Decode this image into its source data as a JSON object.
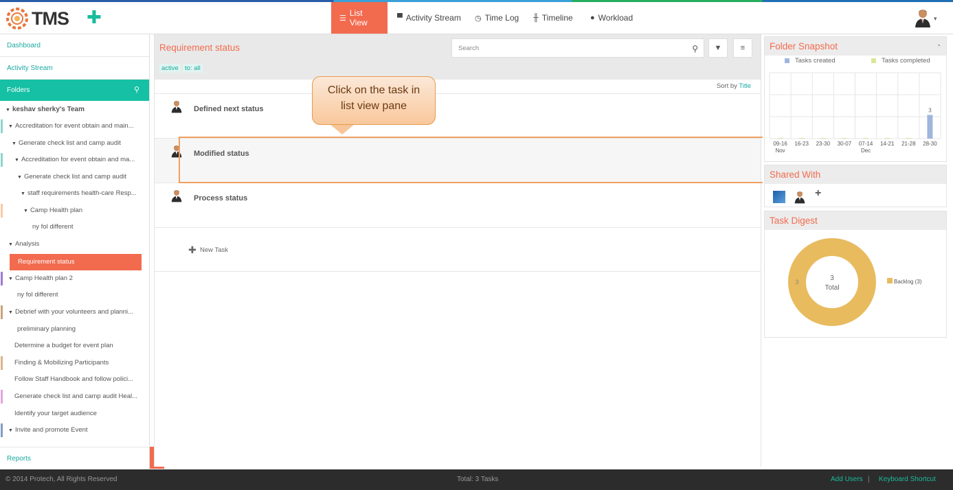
{
  "app": {
    "logo_text": "TMS",
    "add_icon": "plus-icon"
  },
  "nav": {
    "items": [
      {
        "label": "List View",
        "icon": "list-icon",
        "active": true
      },
      {
        "label": "Activity Stream",
        "icon": "comment-icon"
      },
      {
        "label": "Time Log",
        "icon": "clock-icon"
      },
      {
        "label": "Timeline",
        "icon": "sliders-icon"
      },
      {
        "label": "Workload",
        "icon": "user-icon"
      }
    ],
    "caret": "▾"
  },
  "sidebar": {
    "dashboard": "Dashboard",
    "activity_stream": "Activity Stream",
    "folders": "Folders",
    "team": "keshav sherky's Team",
    "tree": [
      {
        "label": "Accreditation for event obtain and main...",
        "bar": "#8fd3cf"
      },
      {
        "label": "Generate check list and camp audit"
      },
      {
        "label": "Accreditation for event obtain and ma...",
        "bar": "#8fd3cf"
      },
      {
        "label": "Generate check list and camp audit"
      },
      {
        "label": "staff requirements health-care Resp..."
      },
      {
        "label": "Camp Health plan",
        "bar": "#f9c9a3"
      },
      {
        "label": "ny fol different"
      },
      {
        "label": "Analysis"
      },
      {
        "label": "Requirement status"
      },
      {
        "label": "Camp Health plan 2",
        "bar": "#9b7bd1"
      },
      {
        "label": "ny fol different"
      },
      {
        "label": "Debrief with your volunteers and planni...",
        "bar": "#c9a27e"
      },
      {
        "label": "preliminary planning"
      },
      {
        "label": "Determine a budget for event plan"
      },
      {
        "label": "Finding & Mobilizing Participants",
        "bar": "#d9b48a"
      },
      {
        "label": "Follow Staff Handbook and follow polici..."
      },
      {
        "label": "Generate check list and camp audit Heal...",
        "bar": "#e3a5d6"
      },
      {
        "label": "Identify your target audience"
      },
      {
        "label": "Invite and promote Event",
        "bar": "#7f9fbf"
      }
    ],
    "reports": "Reports",
    "collapse_icon": "|||"
  },
  "main": {
    "title": "Requirement status",
    "search_placeholder": "Search",
    "filters": [
      "active",
      "to: all"
    ],
    "sort_prefix": "Sort by",
    "sort_field": "Title",
    "tasks": [
      "Defined next status",
      "Modified status",
      "Process status"
    ],
    "new_task": "New Task"
  },
  "callout": {
    "line1": "Click on the task in",
    "line2": "list view pane"
  },
  "folder_snapshot": {
    "title": "Folder Snapshot",
    "legend_created": "Tasks created",
    "legend_completed": "Tasks completed",
    "x_labels": [
      "09-16",
      "16-23",
      "23-30",
      "30-07",
      "07-14",
      "14-21",
      "21-28",
      "28-30"
    ],
    "month_labels": {
      "nov": "Nov",
      "dec": "Dec"
    },
    "value_label": "3"
  },
  "shared_with": {
    "title": "Shared With",
    "add": "+"
  },
  "task_digest": {
    "title": "Task Digest",
    "center_value": "3",
    "center_label": "Total",
    "side_value": "3",
    "legend": "Backlog (3)"
  },
  "chart_data": [
    {
      "type": "bar",
      "title": "Folder Snapshot",
      "categories": [
        "09-16",
        "16-23",
        "23-30",
        "30-07",
        "07-14",
        "14-21",
        "21-28",
        "28-30"
      ],
      "series": [
        {
          "name": "Tasks created",
          "values": [
            0,
            0,
            0,
            0,
            0,
            0,
            0,
            3
          ],
          "color": "#9fb5dd"
        },
        {
          "name": "Tasks completed",
          "values": [
            0,
            0,
            0,
            0,
            0,
            0,
            0,
            0
          ],
          "color": "#d8e89a"
        }
      ]
    },
    {
      "type": "pie",
      "title": "Task Digest",
      "categories": [
        "Backlog (3)"
      ],
      "values": [
        3
      ],
      "colors": [
        "#e8bb5f"
      ]
    }
  ],
  "footer": {
    "copyright": "© 2014 Protech, All Rights Reserved",
    "total": "Total: 3 Tasks",
    "add_users": "Add Users",
    "sep": "|",
    "keyboard": "Keyboard Shortcut"
  },
  "colors": {
    "accent": "#f26b4f",
    "teal": "#15c0a4",
    "footer_bg": "#2c2c2c"
  }
}
